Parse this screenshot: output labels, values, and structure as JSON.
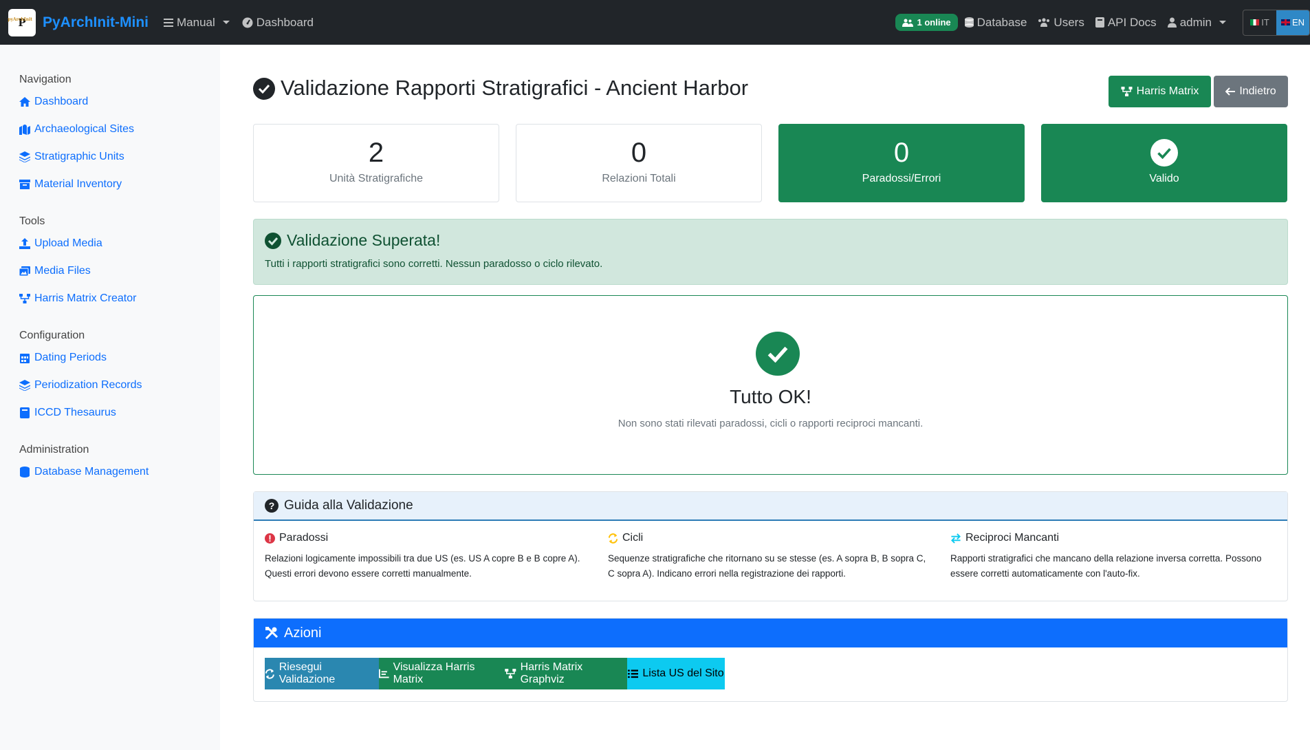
{
  "navbar": {
    "brand_logo_text": "P",
    "brand_logo_small": "pyArchInit",
    "brand_name": "PyArchInit-Mini",
    "manual": "Manual",
    "dashboard": "Dashboard",
    "online": "1 online",
    "database": "Database",
    "users": "Users",
    "api_docs": "API Docs",
    "admin": "admin",
    "lang_it": "IT",
    "lang_en": "EN"
  },
  "sidebar": {
    "navigation_title": "Navigation",
    "navigation_items": [
      "Dashboard",
      "Archaeological Sites",
      "Stratigraphic Units",
      "Material Inventory"
    ],
    "tools_title": "Tools",
    "tools_items": [
      "Upload Media",
      "Media Files",
      "Harris Matrix Creator"
    ],
    "configuration_title": "Configuration",
    "configuration_items": [
      "Dating Periods",
      "Periodization Records",
      "ICCD Thesaurus"
    ],
    "administration_title": "Administration",
    "administration_items": [
      "Database Management"
    ]
  },
  "page": {
    "title": "Validazione Rapporti Stratigrafici - Ancient Harbor",
    "harris_button": "Harris Matrix",
    "back_button": "Indietro"
  },
  "stats": [
    {
      "value": "2",
      "label": "Unità Stratigrafiche"
    },
    {
      "value": "0",
      "label": "Relazioni Totali"
    },
    {
      "value": "0",
      "label": "Paradossi/Errori"
    },
    {
      "label": "Valido"
    }
  ],
  "alert": {
    "title": "Validazione Superata!",
    "text": "Tutti i rapporti stratigrafici sono corretti. Nessun paradosso o ciclo rilevato."
  },
  "ok": {
    "title": "Tutto OK!",
    "text": "Non sono stati rilevati paradossi, cicli o rapporti reciproci mancanti."
  },
  "guide": {
    "title": "Guida alla Validazione",
    "columns": [
      {
        "title": "Paradossi",
        "text": "Relazioni logicamente impossibili tra due US (es. US A copre B e B copre A). Questi errori devono essere corretti manualmente."
      },
      {
        "title": "Cicli",
        "text": "Sequenze stratigrafiche che ritornano su se stesse (es. A sopra B, B sopra C, C sopra A). Indicano errori nella registrazione dei rapporti."
      },
      {
        "title": "Reciproci Mancanti",
        "text": "Rapporti stratigrafici che mancano della relazione inversa corretta. Possono essere corretti automaticamente con l'auto-fix."
      }
    ]
  },
  "actions": {
    "title": "Azioni",
    "buttons": [
      "Riesegui Validazione",
      "Visualizza Harris Matrix",
      "Harris Matrix Graphviz",
      "Lista US del Sito"
    ]
  },
  "colors": {
    "success": "#198754",
    "primary": "#0d6efd",
    "info": "#0dcaf0",
    "secondary": "#6c757d",
    "navbar": "#212529"
  }
}
